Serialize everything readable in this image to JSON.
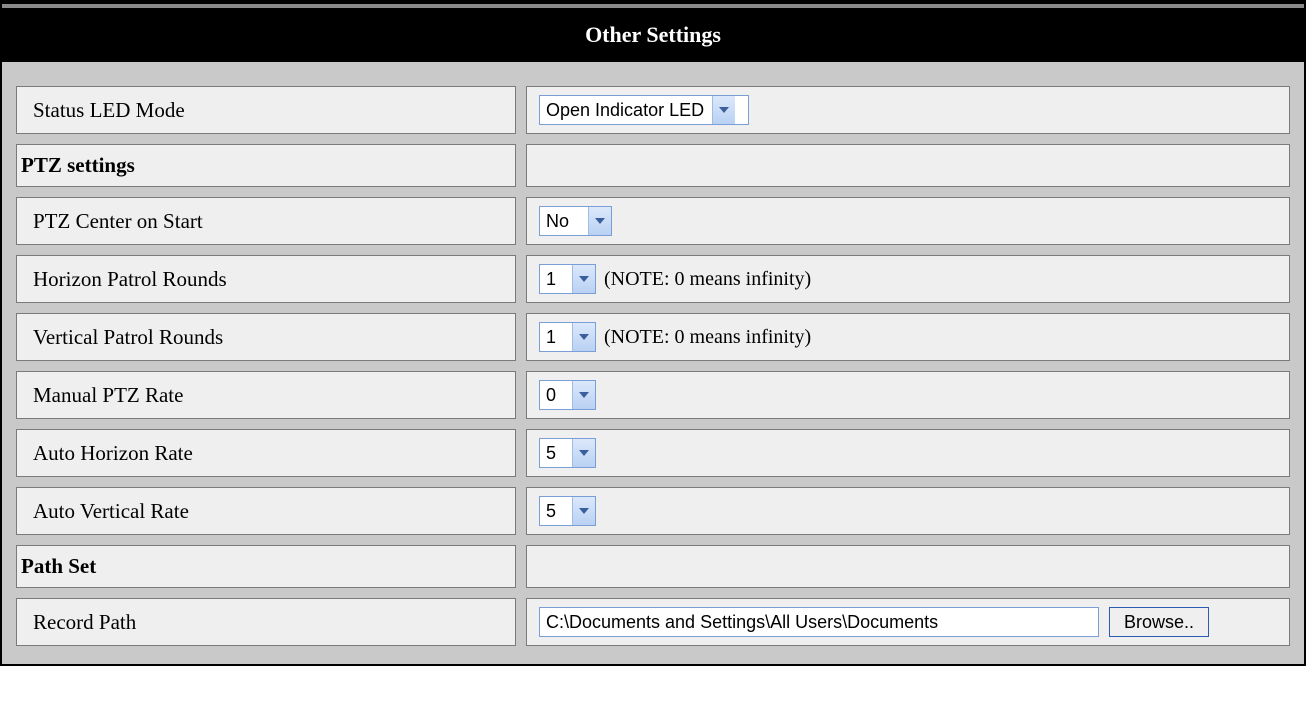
{
  "page_title": "Other Settings",
  "sections": {
    "ptz_heading": "PTZ settings",
    "pathset_heading": "Path Set"
  },
  "rows": {
    "status_led": {
      "label": "Status LED Mode",
      "selected": "Open Indicator LED"
    },
    "ptz_center": {
      "label": "PTZ Center on Start",
      "selected": "No"
    },
    "horizon_patrol": {
      "label": "Horizon Patrol Rounds",
      "selected": "1",
      "note": "(NOTE: 0 means infinity)"
    },
    "vertical_patrol": {
      "label": "Vertical Patrol Rounds",
      "selected": "1",
      "note": "(NOTE: 0 means infinity)"
    },
    "manual_rate": {
      "label": "Manual PTZ Rate",
      "selected": "0"
    },
    "auto_horizon_rate": {
      "label": "Auto Horizon Rate",
      "selected": "5"
    },
    "auto_vertical_rate": {
      "label": "Auto Vertical Rate",
      "selected": "5"
    },
    "record_path": {
      "label": "Record Path",
      "value": "C:\\Documents and Settings\\All Users\\Documents",
      "browse_label": "Browse.."
    }
  }
}
